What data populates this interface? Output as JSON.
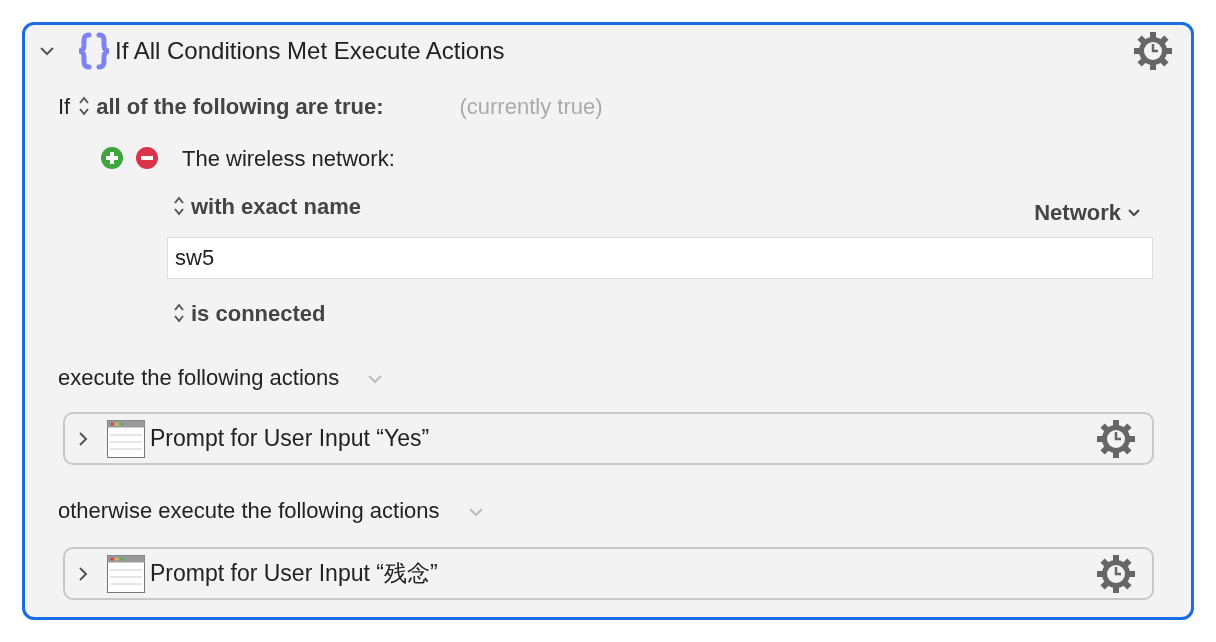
{
  "action": {
    "title": "If All Conditions Met Execute Actions",
    "expanded": true
  },
  "condition": {
    "prefix": "If",
    "mode": "all of the following are true:",
    "status": "(currently true)"
  },
  "conditions": [
    {
      "label": "The wireless network:",
      "match": "with exact name",
      "token_menu": "Network",
      "value": "sw5",
      "state": "is connected"
    }
  ],
  "branches": [
    {
      "label": "execute the following actions",
      "actions": [
        {
          "title": "Prompt for User Input “Yes”",
          "expanded": false
        }
      ]
    },
    {
      "label": "otherwise execute the following actions",
      "actions": [
        {
          "title": "Prompt for User Input “残念”",
          "expanded": false
        }
      ]
    }
  ]
}
